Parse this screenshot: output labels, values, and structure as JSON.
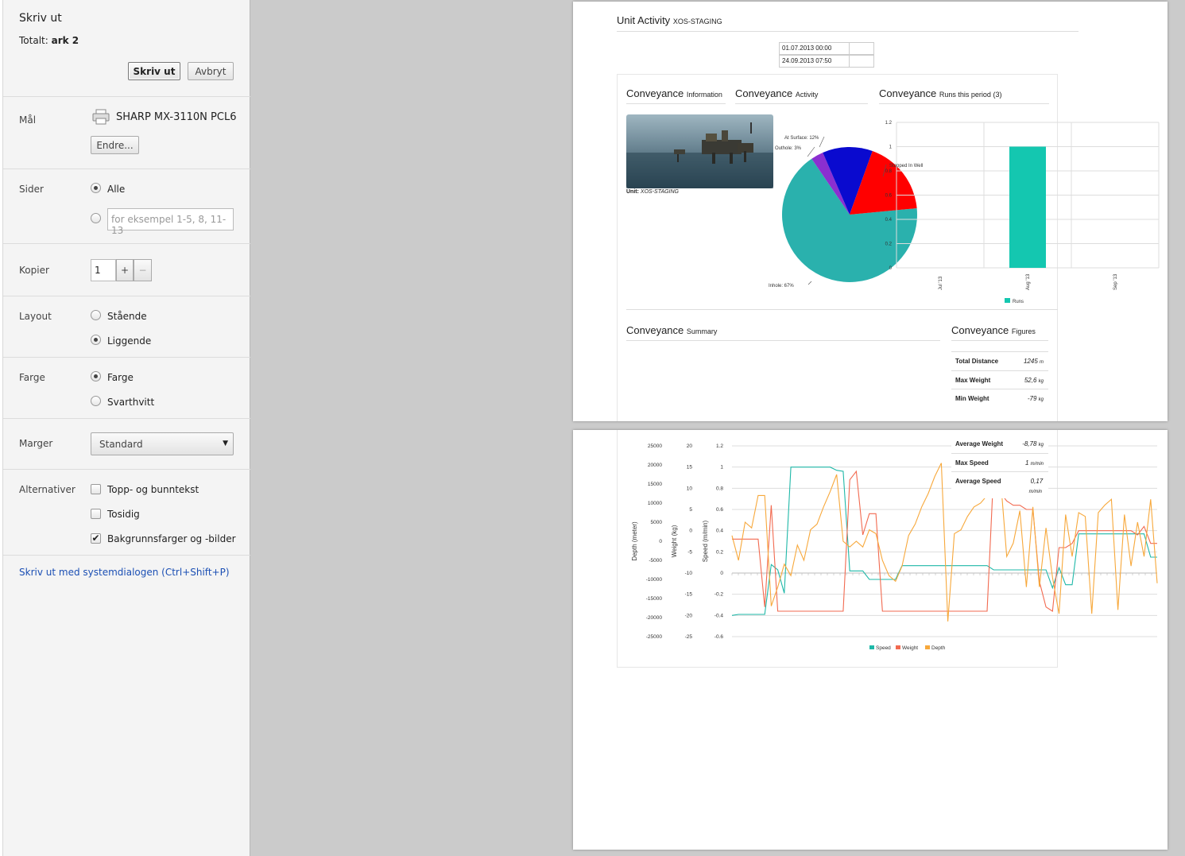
{
  "dialog": {
    "title": "Skriv ut",
    "total_label": "Totalt: ",
    "total_value": "ark 2",
    "print_button": "Skriv ut",
    "cancel_button": "Avbryt",
    "destination_label": "Mål",
    "printer_name": "SHARP MX-3110N PCL6",
    "change_button": "Endre...",
    "pages_label": "Sider",
    "pages_all": "Alle",
    "pages_placeholder": "for eksempel 1-5, 8, 11-13",
    "copies_label": "Kopier",
    "copies_value": "1",
    "copies_plus": "+",
    "copies_minus": "−",
    "layout_label": "Layout",
    "layout_portrait": "Stående",
    "layout_landscape": "Liggende",
    "color_label": "Farge",
    "color_color": "Farge",
    "color_bw": "Svarthvitt",
    "margins_label": "Marger",
    "margins_value": "Standard",
    "options_label": "Alternativer",
    "opt_header_footer": "Topp- og bunntekst",
    "opt_duplex": "Tosidig",
    "opt_background": "Bakgrunnsfarger og -bilder",
    "system_dialog_link": "Skriv ut med systemdialogen (Ctrl+Shift+P)",
    "selected": {
      "pages": "Alle",
      "layout": "Liggende",
      "color": "Farge",
      "background_graphics": true,
      "header_footer": false,
      "duplex": false
    }
  },
  "report": {
    "title": "Unit Activity",
    "unit_code": "XOS-STAGING",
    "date_from": "01.07.2013 00:00",
    "date_to": "24.09.2013 07:50",
    "info_header": "Conveyance",
    "info_sub": "Information",
    "activity_header": "Conveyance",
    "activity_sub": "Activity",
    "runs_header": "Conveyance",
    "runs_sub": "Runs this period (3)",
    "unit_label": "Unit:",
    "unit_value": "XOS-STAGING",
    "summary_header": "Conveyance",
    "summary_sub": "Summary",
    "figures_header": "Conveyance",
    "figures_sub": "Figures",
    "figures": [
      {
        "label": "Total Distance",
        "value": "1245",
        "unit": "m"
      },
      {
        "label": "Max Weight",
        "value": "52,6",
        "unit": "kg"
      },
      {
        "label": "Min Weight",
        "value": "-79",
        "unit": "kg"
      }
    ],
    "figures_page2": [
      {
        "label": "Average Weight",
        "value": "-8,78",
        "unit": "kg"
      },
      {
        "label": "Max Speed",
        "value": "1",
        "unit": "m/min"
      },
      {
        "label": "Average Speed",
        "value": "0,17",
        "unit": "m/min"
      }
    ]
  },
  "chart_data": [
    {
      "type": "pie",
      "slices": [
        {
          "label": "Inhole: 67%",
          "value": 67,
          "color": "#2ab1ad"
        },
        {
          "label": "Outhole: 3%",
          "value": 3,
          "color": "#8b2fd0"
        },
        {
          "label": "At Surface: 12%",
          "value": 12,
          "color": "#0a0acf"
        },
        {
          "label": "Stopped In Well: 18%",
          "value": 18,
          "color": "#ff0000"
        }
      ]
    },
    {
      "type": "bar",
      "categories": [
        "Jul '13",
        "Aug '13",
        "Sep '13"
      ],
      "series": [
        {
          "name": "Runs",
          "values": [
            0,
            1,
            0
          ],
          "color": "#14c7b0"
        }
      ],
      "ylim": [
        0,
        1.2
      ],
      "yticks": [
        "0",
        "0.2",
        "0.4",
        "0.6",
        "0.8",
        "1",
        "1.2"
      ],
      "legend": "bottom-center"
    },
    {
      "type": "line",
      "y_axes": [
        {
          "label": "Depth (meter)",
          "ticks": [
            "25000",
            "20000",
            "15000",
            "10000",
            "5000",
            "0",
            "-5000",
            "-10000",
            "-15000",
            "-20000",
            "-25000"
          ]
        },
        {
          "label": "Weight (kg)",
          "ticks": [
            "20",
            "15",
            "10",
            "5",
            "0",
            "-5",
            "-10",
            "-15",
            "-20",
            "-25"
          ]
        },
        {
          "label": "Speed (m/min)",
          "ticks": [
            "1.2",
            "1",
            "0.8",
            "0.6",
            "0.4",
            "0.2",
            "0",
            "-0.2",
            "-0.4",
            "-0.6"
          ]
        }
      ],
      "series": [
        {
          "name": "Speed",
          "color": "#1fb8a8",
          "values": [
            -0.4,
            -0.39,
            -0.39,
            -0.39,
            -0.39,
            -0.39,
            0.08,
            0.03,
            -0.19,
            1.0,
            1.0,
            1.0,
            1.0,
            1.0,
            1.0,
            1.0,
            0.97,
            0.96,
            0.02,
            0.02,
            0.02,
            -0.06,
            -0.06,
            -0.06,
            -0.06,
            -0.06,
            0.07,
            0.07,
            0.07,
            0.07,
            0.07,
            0.07,
            0.07,
            0.07,
            0.07,
            0.07,
            0.07,
            0.07,
            0.07,
            0.07,
            0.03,
            0.03,
            0.03,
            0.03,
            0.03,
            0.03,
            0.03,
            0.03,
            0.03,
            -0.14,
            0.05,
            -0.11,
            -0.11,
            0.37,
            0.37,
            0.37,
            0.37,
            0.37,
            0.37,
            0.37,
            0.37,
            0.37,
            0.37,
            0.37,
            0.15,
            0.15
          ]
        },
        {
          "name": "Weight",
          "color": "#f26a50",
          "values": [
            -2,
            -2,
            -2,
            -2,
            -2,
            -18,
            6,
            -19,
            -19,
            -19,
            -19,
            -19,
            -19,
            -19,
            -19,
            -19,
            -19,
            -19,
            12,
            14,
            -1,
            4,
            4,
            -19,
            -19,
            -19,
            -19,
            -19,
            -19,
            -19,
            -19,
            -19,
            -19,
            -19,
            -19,
            -19,
            -19,
            -19,
            -19,
            -19,
            14,
            9,
            7,
            6,
            6,
            5,
            5,
            -12,
            -18,
            -19,
            -4,
            -4,
            -3,
            0,
            0,
            0,
            0,
            0,
            0,
            0,
            0,
            0,
            -1,
            1,
            -3,
            -3
          ]
        },
        {
          "name": "Depth",
          "color": "#f7a83b",
          "values": [
            1500,
            -5000,
            5000,
            3500,
            12000,
            12000,
            -17000,
            -12000,
            -6000,
            -9000,
            -1000,
            -5000,
            3000,
            4500,
            9000,
            13000,
            17500,
            0,
            -1500,
            0,
            -1500,
            3000,
            2000,
            -5000,
            -9000,
            -10500,
            -6500,
            1500,
            4500,
            9000,
            12500,
            17000,
            20500,
            -21000,
            2000,
            3000,
            6500,
            9000,
            10000,
            12000,
            14000,
            17500,
            -4000,
            -500,
            8000,
            -12000,
            9000,
            -12000,
            3500,
            -9500,
            -19000,
            7000,
            -4000,
            7500,
            6500,
            -19000,
            7500,
            9500,
            11000,
            -18000,
            7000,
            -6500,
            5000,
            -4000,
            11000,
            -11000
          ]
        }
      ],
      "legend": "bottom-center"
    }
  ]
}
